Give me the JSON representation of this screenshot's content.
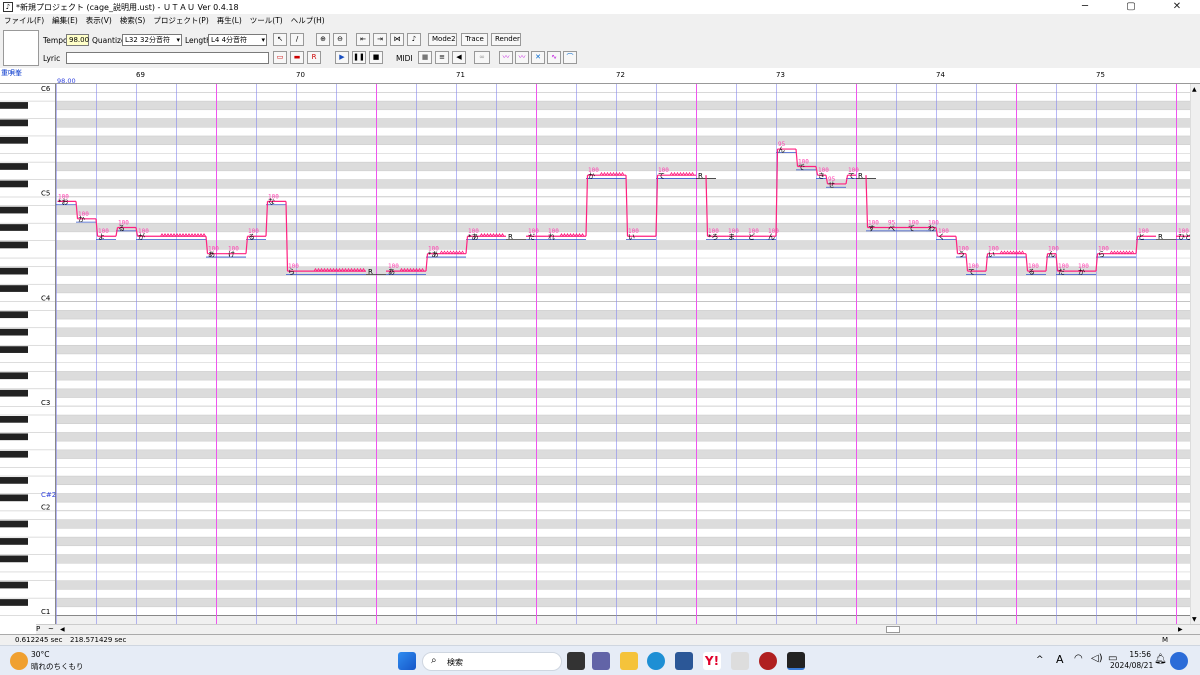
{
  "window": {
    "title": "*新規プロジェクト (cage_説明用.ust) - ＵＴＡＵ Ver 0.4.18",
    "minimize": "─",
    "maximize": "▢",
    "close": "✕"
  },
  "menu": [
    "ファイル(F)",
    "編集(E)",
    "表示(V)",
    "検索(S)",
    "プロジェクト(P)",
    "再生(L)",
    "ツール(T)",
    "ヘルプ(H)"
  ],
  "toolbar": {
    "tempo_label": "Tempo",
    "tempo_value": "98.00",
    "quantize_label": "Quantize",
    "quantize_value": "L32 32分音符",
    "length_label": "Length",
    "length_value": "L4  4分音符",
    "lyric_label": "Lyric",
    "lyric_value": "",
    "mode2": "Mode2",
    "trace": "Trace",
    "render": "Render",
    "midi": "MIDI",
    "r_button": "R"
  },
  "editor": {
    "singer": "重唄峯",
    "tempo_marker": "98.00",
    "measures": [
      "69",
      "70",
      "71",
      "72",
      "73",
      "74",
      "75"
    ],
    "octave_labels": [
      "C6",
      "C5",
      "C4",
      "C3",
      "C#2",
      "C2",
      "C1"
    ],
    "notes": [
      {
        "lyric": "*お",
        "pitch": 71,
        "start": 0,
        "len": 2,
        "vel": "100"
      },
      {
        "lyric": "か",
        "pitch": 69,
        "start": 2,
        "len": 2,
        "vel": "100"
      },
      {
        "lyric": "よ",
        "pitch": 67,
        "start": 4,
        "len": 2,
        "vel": "100"
      },
      {
        "lyric": "る",
        "pitch": 68,
        "start": 6,
        "len": 2,
        "vel": "100"
      },
      {
        "lyric": "が",
        "pitch": 67,
        "start": 8,
        "len": 7,
        "vel": "100"
      },
      {
        "lyric": "あ",
        "pitch": 65,
        "start": 15,
        "len": 2,
        "vel": "100"
      },
      {
        "lyric": "け",
        "pitch": 65,
        "start": 17,
        "len": 2,
        "vel": "100"
      },
      {
        "lyric": "る",
        "pitch": 67,
        "start": 19,
        "len": 2,
        "vel": "100"
      },
      {
        "lyric": "な",
        "pitch": 71,
        "start": 21,
        "len": 2,
        "vel": "100"
      },
      {
        "lyric": "ら",
        "pitch": 63,
        "start": 23,
        "len": 8,
        "vel": "100"
      },
      {
        "lyric": "R",
        "pitch": 63,
        "start": 31,
        "len": 2,
        "vel": ""
      },
      {
        "lyric": "あ",
        "pitch": 63,
        "start": 33,
        "len": 4,
        "vel": "100"
      },
      {
        "lyric": "*あ",
        "pitch": 65,
        "start": 37,
        "len": 4,
        "vel": "100"
      },
      {
        "lyric": "*あ",
        "pitch": 67,
        "start": 41,
        "len": 4,
        "vel": "100"
      },
      {
        "lyric": "R",
        "pitch": 67,
        "start": 45,
        "len": 2,
        "vel": ""
      },
      {
        "lyric": "だ",
        "pitch": 67,
        "start": 47,
        "len": 2,
        "vel": "100"
      },
      {
        "lyric": "れ",
        "pitch": 67,
        "start": 49,
        "len": 4,
        "vel": "100"
      },
      {
        "lyric": "か",
        "pitch": 74,
        "start": 53,
        "len": 4,
        "vel": "100"
      },
      {
        "lyric": "い",
        "pitch": 67,
        "start": 57,
        "len": 3,
        "vel": "100"
      },
      {
        "lyric": "て",
        "pitch": 74,
        "start": 60,
        "len": 4,
        "vel": "100"
      },
      {
        "lyric": "R",
        "pitch": 74,
        "start": 64,
        "len": 2,
        "vel": ""
      },
      {
        "lyric": "*ろ",
        "pitch": 67,
        "start": 65,
        "len": 2,
        "vel": "100"
      },
      {
        "lyric": "ま",
        "pitch": 67,
        "start": 67,
        "len": 2,
        "vel": "100"
      },
      {
        "lyric": "ど",
        "pitch": 67,
        "start": 69,
        "len": 2,
        "vel": "100"
      },
      {
        "lyric": "ん",
        "pitch": 67,
        "start": 71,
        "len": 1,
        "vel": "100"
      },
      {
        "lyric": "ん",
        "pitch": 77,
        "start": 72,
        "len": 2,
        "vel": "95"
      },
      {
        "lyric": "で",
        "pitch": 75,
        "start": 74,
        "len": 2,
        "vel": "100"
      },
      {
        "lyric": "き",
        "pitch": 74,
        "start": 76,
        "len": 1,
        "vel": "100"
      },
      {
        "lyric": "せ",
        "pitch": 73,
        "start": 77,
        "len": 2,
        "vel": "95"
      },
      {
        "lyric": "て",
        "pitch": 74,
        "start": 79,
        "len": 1,
        "vel": "100"
      },
      {
        "lyric": "R",
        "pitch": 74,
        "start": 80,
        "len": 2,
        "vel": ""
      },
      {
        "lyric": "す",
        "pitch": 68,
        "start": 81,
        "len": 2,
        "vel": "100"
      },
      {
        "lyric": "べ",
        "pitch": 68,
        "start": 83,
        "len": 2,
        "vel": "95"
      },
      {
        "lyric": "て",
        "pitch": 68,
        "start": 85,
        "len": 2,
        "vel": "100"
      },
      {
        "lyric": "わ",
        "pitch": 68,
        "start": 87,
        "len": 1,
        "vel": "100"
      },
      {
        "lyric": "く",
        "pitch": 67,
        "start": 88,
        "len": 2,
        "vel": "100"
      },
      {
        "lyric": "う",
        "pitch": 65,
        "start": 90,
        "len": 1,
        "vel": "100"
      },
      {
        "lyric": "て",
        "pitch": 63,
        "start": 91,
        "len": 2,
        "vel": "100"
      },
      {
        "lyric": "い",
        "pitch": 65,
        "start": 93,
        "len": 4,
        "vel": "100"
      },
      {
        "lyric": "る",
        "pitch": 63,
        "start": 97,
        "len": 2,
        "vel": "100"
      },
      {
        "lyric": "ん",
        "pitch": 65,
        "start": 99,
        "len": 1,
        "vel": "100"
      },
      {
        "lyric": "だ",
        "pitch": 63,
        "start": 100,
        "len": 2,
        "vel": "100"
      },
      {
        "lyric": "か",
        "pitch": 63,
        "start": 102,
        "len": 2,
        "vel": "100"
      },
      {
        "lyric": "ら",
        "pitch": 65,
        "start": 104,
        "len": 4,
        "vel": "100"
      },
      {
        "lyric": "と",
        "pitch": 67,
        "start": 108,
        "len": 2,
        "vel": "100"
      },
      {
        "lyric": "R",
        "pitch": 67,
        "start": 110,
        "len": 2,
        "vel": ""
      },
      {
        "lyric": "ひと",
        "pitch": 67,
        "start": 112,
        "len": 3,
        "vel": "100"
      },
      {
        "lyric": "り",
        "pitch": 68,
        "start": 115,
        "len": 2,
        "vel": "100"
      },
      {
        "lyric": "に",
        "pitch": 74,
        "start": 117,
        "len": 2,
        "vel": "100"
      }
    ]
  },
  "status": {
    "left_time": "0.612245 sec",
    "total_time": "218.571429 sec",
    "tab_p": "P",
    "tab_m": "M"
  },
  "taskbar": {
    "weather_temp": "30°C",
    "weather_desc": "晴れのちくもり",
    "search_placeholder": "検索",
    "time": "15:56",
    "date": "2024/08/21",
    "ime": "A"
  }
}
